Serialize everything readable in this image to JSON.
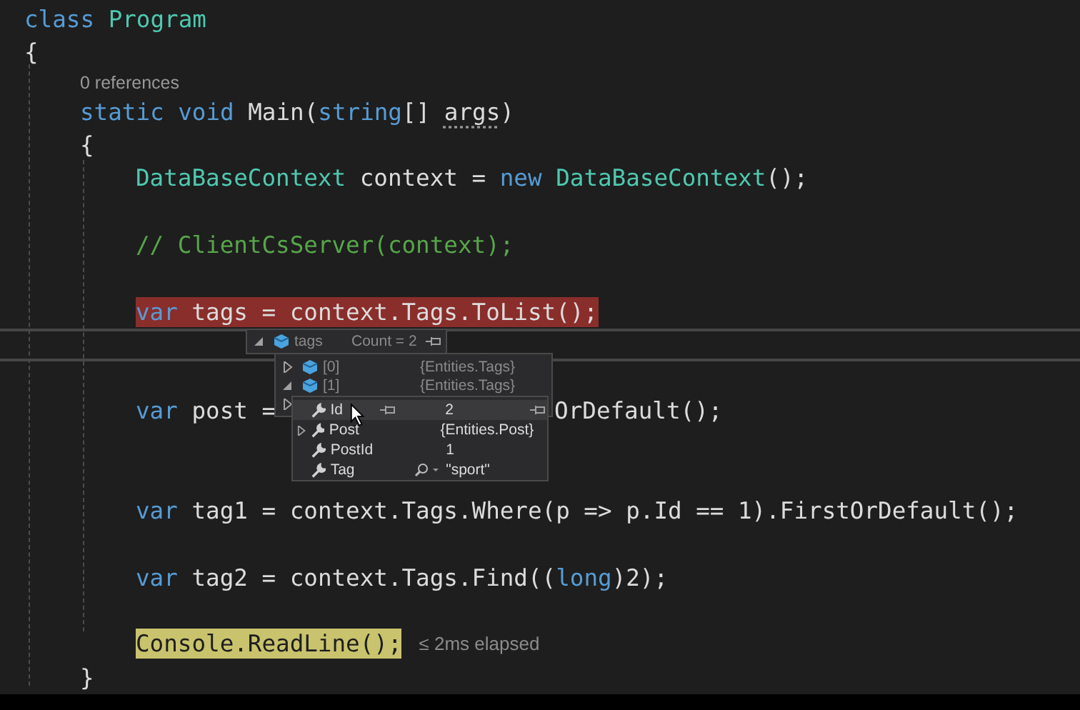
{
  "editor": {
    "lines": [
      {
        "kind": "code",
        "tokens": [
          {
            "text": "class",
            "kind": "keyword"
          },
          {
            "text": " Program",
            "kind": "type"
          }
        ]
      },
      {
        "kind": "code",
        "tokens": [
          {
            "text": "{",
            "kind": "plain"
          }
        ]
      },
      {
        "kind": "block",
        "children": [
          {
            "kind": "codelens",
            "text": "0 references"
          },
          {
            "kind": "code",
            "tokens": [
              {
                "text": "static void",
                "kind": "keyword"
              },
              {
                "text": " Main(",
                "kind": "plain"
              },
              {
                "text": "string",
                "kind": "keyword"
              },
              {
                "text": "[] ",
                "kind": "plain"
              },
              {
                "text": "args",
                "kind": "hint"
              },
              {
                "text": ")",
                "kind": "plain"
              }
            ]
          },
          {
            "kind": "code",
            "tokens": [
              {
                "text": "{",
                "kind": "plain"
              }
            ]
          },
          {
            "kind": "block",
            "children": [
              {
                "kind": "code",
                "tokens": [
                  {
                    "text": "DataBaseContext",
                    "kind": "type"
                  },
                  {
                    "text": " context = ",
                    "kind": "plain"
                  },
                  {
                    "text": "new",
                    "kind": "keyword"
                  },
                  {
                    "text": " DataBaseContext",
                    "kind": "type"
                  },
                  {
                    "text": "();",
                    "kind": "plain"
                  }
                ]
              },
              {
                "kind": "blank"
              },
              {
                "kind": "code",
                "tokens": [
                  {
                    "text": "// ClientCsServer(context);",
                    "kind": "comment"
                  }
                ]
              },
              {
                "kind": "blank"
              },
              {
                "kind": "code",
                "breakpoint": true,
                "tokens": [
                  {
                    "text": "var",
                    "kind": "keyword"
                  },
                  {
                    "text": " tags = context.Tags.ToList();",
                    "kind": "plain"
                  }
                ]
              },
              {
                "kind": "blank",
                "caret_line": true
              },
              {
                "kind": "blank"
              },
              {
                "kind": "covered",
                "parts": [
                  [
                    {
                      "text": "var",
                      "kind": "keyword"
                    },
                    {
                      "text": " post =",
                      "kind": "plain"
                    }
                  ],
                  [
                    {
                      "text": "OrDefault();",
                      "kind": "plain"
                    }
                  ]
                ]
              },
              {
                "kind": "blank"
              },
              {
                "kind": "blank"
              },
              {
                "kind": "code",
                "tokens": [
                  {
                    "text": "var",
                    "kind": "keyword"
                  },
                  {
                    "text": " tag1 = context.Tags.Where(p => p.Id == 1).FirstOrDefault();",
                    "kind": "plain"
                  }
                ]
              },
              {
                "kind": "blank"
              },
              {
                "kind": "code",
                "tokens": [
                  {
                    "text": "var",
                    "kind": "keyword"
                  },
                  {
                    "text": " tag2 = context.Tags.Find((",
                    "kind": "plain"
                  },
                  {
                    "text": "long",
                    "kind": "keyword"
                  },
                  {
                    "text": ")2);",
                    "kind": "plain"
                  }
                ]
              },
              {
                "kind": "blank"
              },
              {
                "kind": "code",
                "current_statement": true,
                "perf_tip": "≤ 2ms elapsed",
                "tokens": [
                  {
                    "text": "Console.ReadLine();",
                    "kind": "plain"
                  }
                ]
              }
            ]
          },
          {
            "kind": "code",
            "tokens": [
              {
                "text": "}",
                "kind": "plain"
              }
            ]
          }
        ]
      }
    ]
  },
  "datatip": {
    "name": "tags",
    "value": "Count = 2",
    "expanded": true,
    "children": [
      {
        "name": "[0]",
        "value": "{Entities.Tags}",
        "expanded": false
      },
      {
        "name": "[1]",
        "value": "{Entities.Tags}",
        "expanded": true
      },
      {
        "expanded": false
      }
    ],
    "members": [
      {
        "name": "Id",
        "value": "2",
        "expandable": false,
        "hovered": true,
        "visualizer": false
      },
      {
        "name": "Post",
        "value": "{Entities.Post}",
        "expandable": true,
        "hovered": false,
        "visualizer": false
      },
      {
        "name": "PostId",
        "value": "1",
        "expandable": false,
        "hovered": false,
        "visualizer": false
      },
      {
        "name": "Tag",
        "value": "\"sport\"",
        "expandable": false,
        "hovered": false,
        "visualizer": true
      }
    ]
  }
}
